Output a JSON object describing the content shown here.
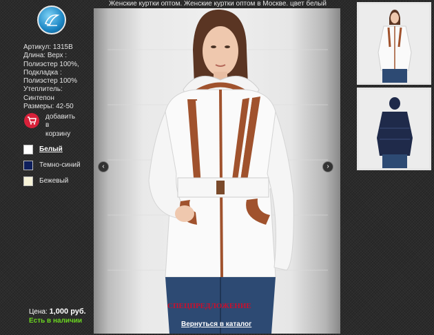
{
  "title": "Женские куртки оптом. Женские куртки оптом в Москве. цвет белый",
  "logo": {
    "icon": "brand-logo-icon"
  },
  "product": {
    "info_lines": [
      "Артикул: 1315B",
      "Длина: Верх :",
      "Полиэстер 100%,",
      "Подкладка :",
      "Полиэстер 100%",
      "Утеплитель:",
      "Синтепон",
      "Размеры: 42-50"
    ]
  },
  "cart": {
    "lines": [
      "добавить",
      "в",
      "корзину"
    ],
    "icon": "cart-icon"
  },
  "colors": [
    {
      "label": "Белый",
      "swatch": "#ffffff",
      "selected": true
    },
    {
      "label": "Темно-синий",
      "swatch": "#0e1f5c",
      "selected": false
    },
    {
      "label": "Бежевый",
      "swatch": "#f7f3d8",
      "selected": false
    }
  ],
  "price": {
    "label": "Цена:",
    "value": "1,000 руб."
  },
  "stock": "Есть в наличии",
  "special_offer": "СПЕЦПРЕДЛОЖЕНИЕ",
  "back_link": "Вернуться в каталог",
  "nav": {
    "prev": "‹",
    "next": "›"
  },
  "accent_colors": {
    "special": "#c8102e",
    "stock": "#6bd620",
    "trim": "#a0522d"
  }
}
